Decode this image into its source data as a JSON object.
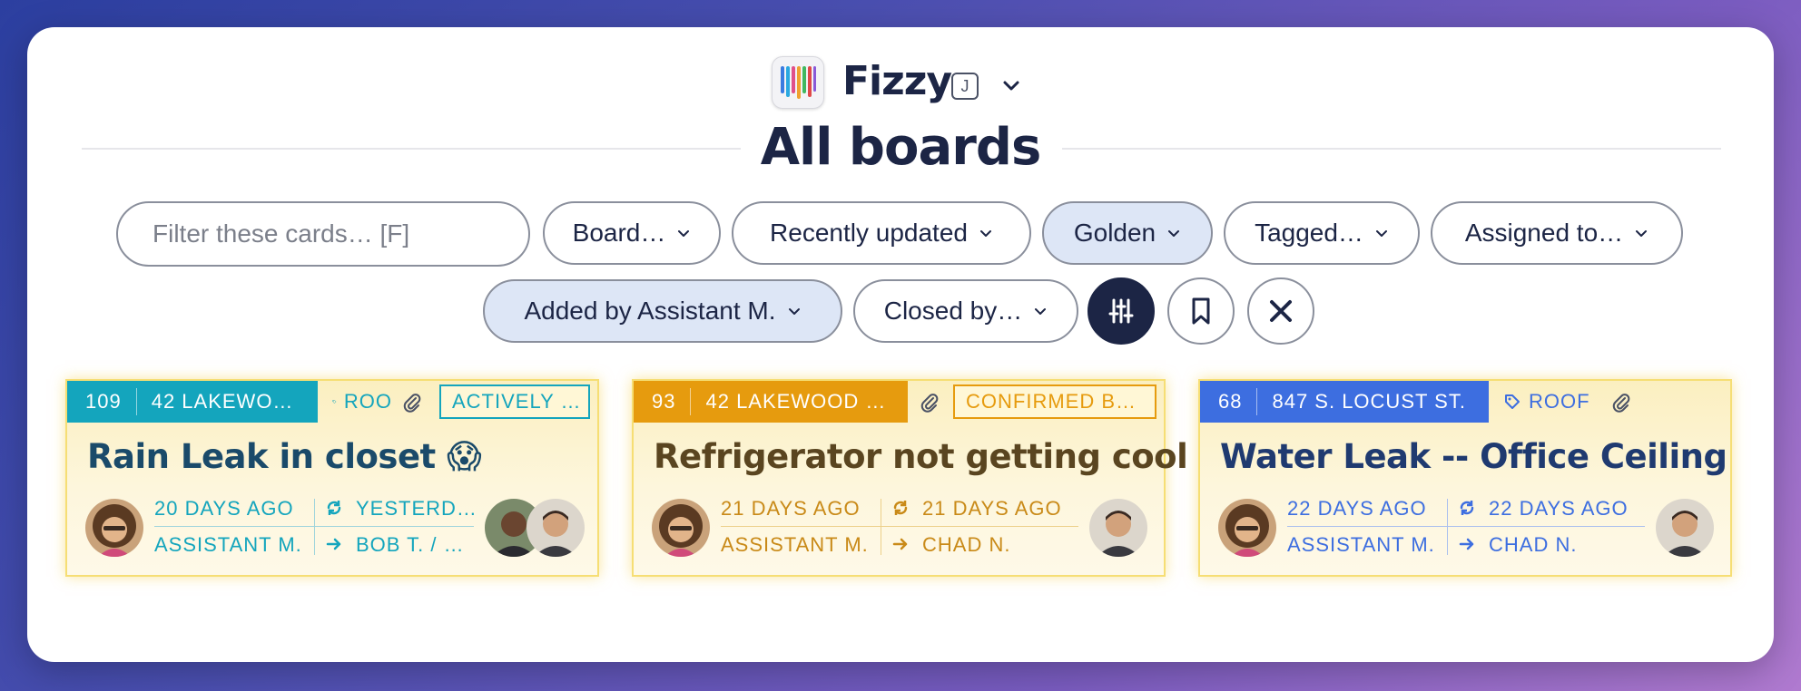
{
  "app": {
    "name": "Fizzy",
    "shortcut": "J",
    "logo_icon": "piano-keys-logo-icon"
  },
  "page": {
    "title": "All boards"
  },
  "filters": {
    "search_placeholder": "Filter these cards… [F]",
    "board": "Board…",
    "sort": "Recently updated",
    "golden": "Golden",
    "tagged": "Tagged…",
    "assigned": "Assigned to…",
    "added_by": "Added by Assistant M.",
    "closed_by": "Closed by…"
  },
  "colors": {
    "teal": "#14a5bd",
    "orange": "#e69b0e",
    "blue": "#3d6ee0",
    "ink": "#1c2545",
    "active_pill": "#dde6f6"
  },
  "cards": [
    {
      "number": "109",
      "board": "42 LAKEWO…",
      "tag": "ROO",
      "status": "ACTIVELY …",
      "title": "Rain Leak in closet 😱",
      "created": "20 DAYS AGO",
      "creator": "ASSISTANT M.",
      "updated": "YESTERD…",
      "assignees": "BOB T. / …"
    },
    {
      "number": "93",
      "board": "42 LAKEWOOD …",
      "status": "CONFIRMED B…",
      "title": "Refrigerator not getting cool",
      "created": "21 DAYS AGO",
      "creator": "ASSISTANT M.",
      "updated": "21 DAYS AGO",
      "assignees": "CHAD N."
    },
    {
      "number": "68",
      "board": "847 S. LOCUST ST.",
      "tag": "ROOF",
      "title": "Water Leak -- Office Ceiling",
      "created": "22 DAYS AGO",
      "creator": "ASSISTANT M.",
      "updated": "22 DAYS AGO",
      "assignees": "CHAD N."
    }
  ]
}
